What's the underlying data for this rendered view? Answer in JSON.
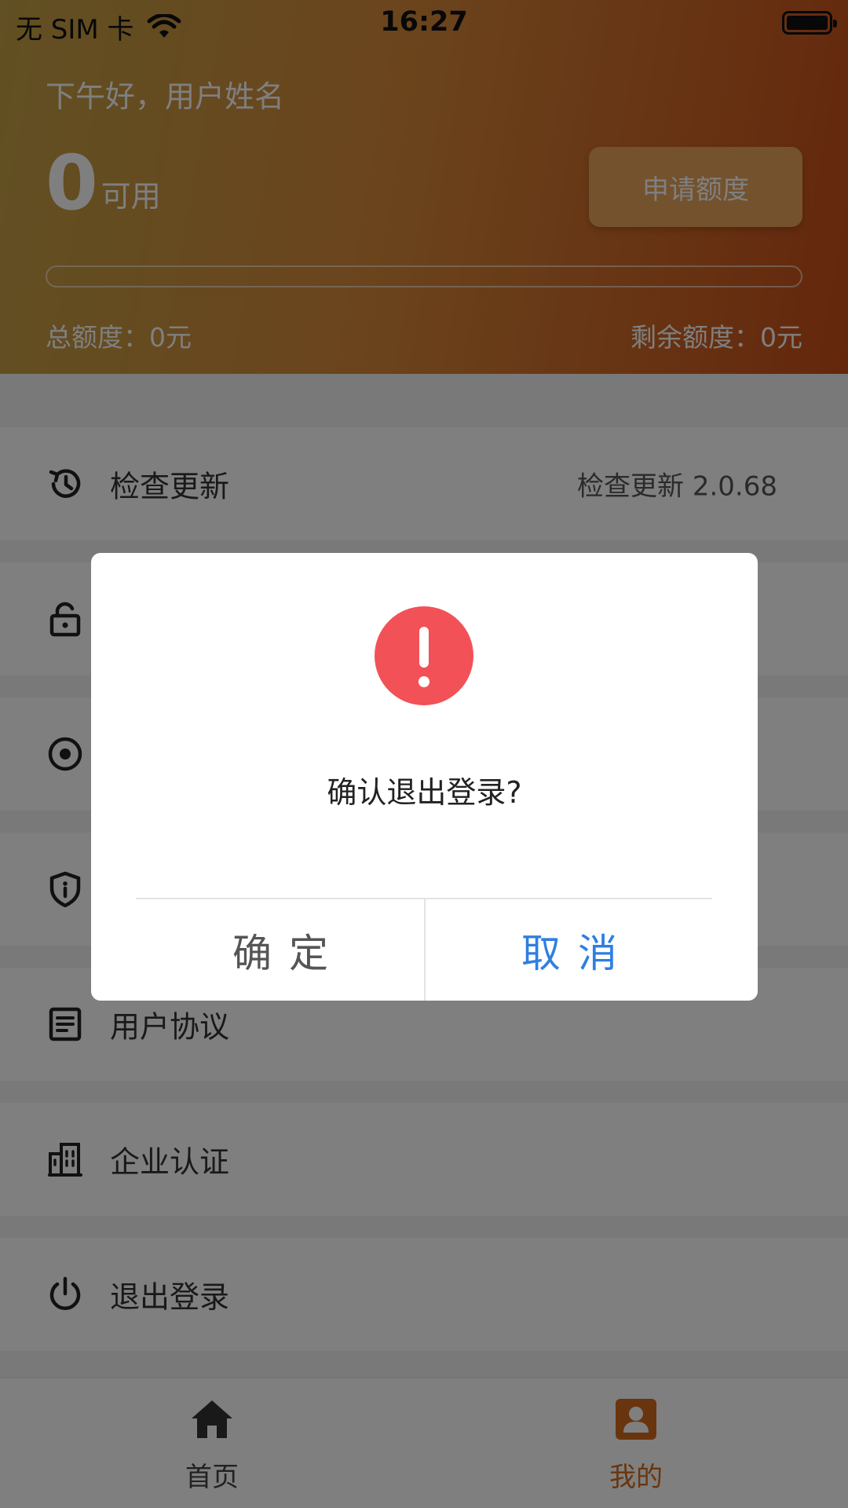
{
  "status_bar": {
    "carrier": "无 SIM 卡",
    "time": "16:27",
    "battery_level": 1.0
  },
  "header": {
    "greeting": "下午好，用户姓名",
    "available_amount": "0",
    "available_unit": "可用",
    "apply_button": "申请额度",
    "progress": 0,
    "total_quota": "总额度：0元",
    "remaining_quota": "剩余额度：0元",
    "colors": {
      "gradient_start": "#c2a046",
      "gradient_end": "#c94e18"
    }
  },
  "menu": {
    "items": [
      {
        "label": "检查更新",
        "value": "检查更新 2.0.68",
        "icon": "history-icon"
      },
      {
        "label": "",
        "icon": "lock-icon"
      },
      {
        "label": "",
        "icon": "target-icon"
      },
      {
        "label": "",
        "icon": "shield-info-icon"
      },
      {
        "label": "用户协议",
        "icon": "document-icon"
      },
      {
        "label": "企业认证",
        "icon": "building-icon"
      },
      {
        "label": "退出登录",
        "icon": "power-icon"
      }
    ]
  },
  "tabbar": {
    "tabs": [
      {
        "label": "首页",
        "icon": "home-icon",
        "active": false
      },
      {
        "label": "我的",
        "icon": "user-icon",
        "active": true
      }
    ],
    "active_color": "#d26a1e"
  },
  "dialog": {
    "icon": "alert-icon",
    "message": "确认退出登录?",
    "confirm_label": "确定",
    "cancel_label": "取消",
    "icon_color": "#f25157",
    "cancel_color": "#2f7fe0"
  }
}
